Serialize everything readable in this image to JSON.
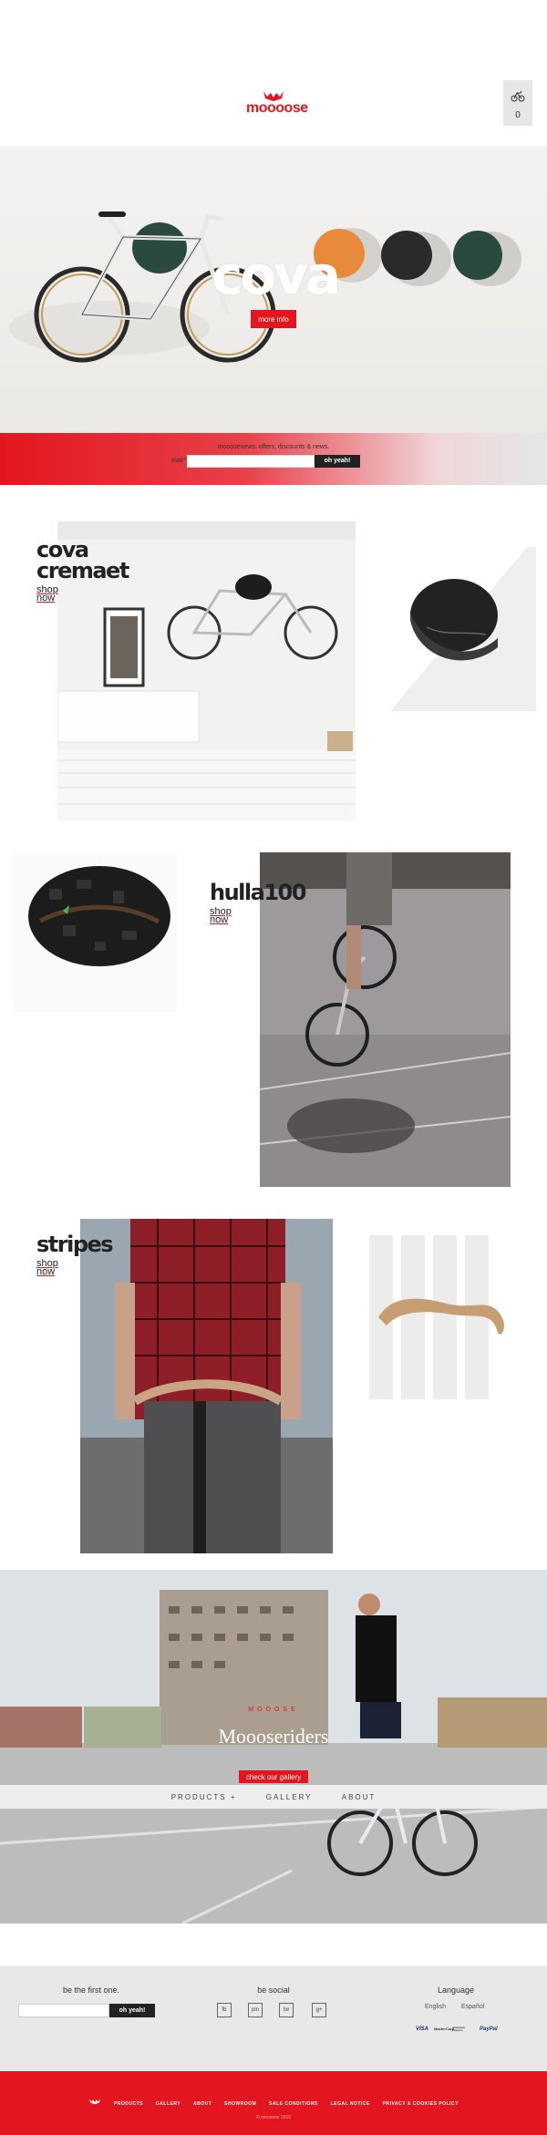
{
  "header": {
    "logo_text": "moooose",
    "cart_count": "0"
  },
  "hero": {
    "title": "cova",
    "button_label": "more info"
  },
  "newsletter": {
    "text": "mooosenews: offers, discounts & news.",
    "label": "mail*",
    "input_value": "",
    "button_label": "oh yeah!"
  },
  "products": [
    {
      "title_line1": "cova",
      "title_line2": "cremaet",
      "shop_line1": "shop",
      "shop_line2": "now"
    },
    {
      "title_line1": "hulla100",
      "shop_line1": "shop",
      "shop_line2": "now"
    },
    {
      "title_line1": "stripes",
      "shop_line1": "shop",
      "shop_line2": "now"
    }
  ],
  "riders": {
    "subtitle": "MOOOSE",
    "title": "Moooseriders",
    "button_label": "check our gallery"
  },
  "nav": {
    "items": [
      "PRODUCTS +",
      "GALLERY",
      "ABOUT"
    ]
  },
  "footer": {
    "newsletter_title": "be the first one.",
    "newsletter_input_value": "",
    "newsletter_button": "oh yeah!",
    "social_title": "be social",
    "social_icons": [
      "fb",
      "pin",
      "tw",
      "g+"
    ],
    "language_title": "Language",
    "languages": [
      "English",
      "Español"
    ],
    "payments": [
      "VISA",
      "MasterCard",
      "American Express",
      "PayPal"
    ]
  },
  "bottom": {
    "links": [
      "PRODUCTS",
      "GALLERY",
      "ABOUT",
      "SHOWROOM",
      "SALE CONDITIONS",
      "LEGAL NOTICE",
      "PRIVACY & COOKIES POLICY"
    ],
    "copyright": "© moooose 2015"
  },
  "colors": {
    "brand_red": "#e3161f",
    "dark": "#222222",
    "light_gray": "#e8e8e8"
  }
}
